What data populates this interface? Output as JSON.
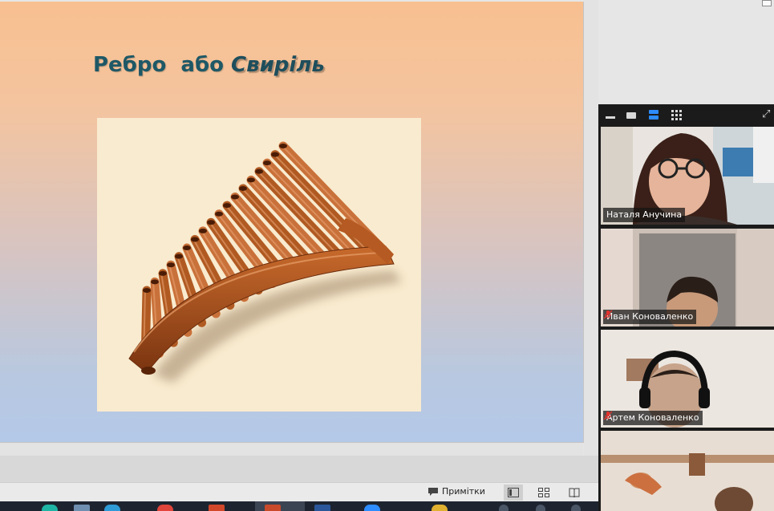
{
  "slide": {
    "title_plain": "Ребро  або ",
    "title_emphasis": "Свиріль",
    "picture_icon": "pan-flute-icon"
  },
  "statusbar": {
    "notes_label": "Примітки",
    "notes_icon": "comment-icon",
    "view_icons": [
      "normal-view-icon",
      "slide-sorter-icon",
      "reading-view-icon"
    ]
  },
  "zoom": {
    "toolbar_icons": [
      "minimize-icon",
      "single-video-icon",
      "video-strip-icon",
      "gallery-grid-icon",
      "expand-icon"
    ],
    "participants": [
      {
        "name": "Наталя Анучина",
        "muted": false,
        "speaking": true
      },
      {
        "name": "Иван Коноваленко",
        "muted": true,
        "speaking": false
      },
      {
        "name": "Артем Коноваленко",
        "muted": true,
        "speaking": false
      },
      {
        "name": "",
        "muted": false,
        "speaking": false
      }
    ],
    "accent_color": "#2d8cff",
    "speaking_color": "#31d36b",
    "muted_color": "#e5322d"
  }
}
